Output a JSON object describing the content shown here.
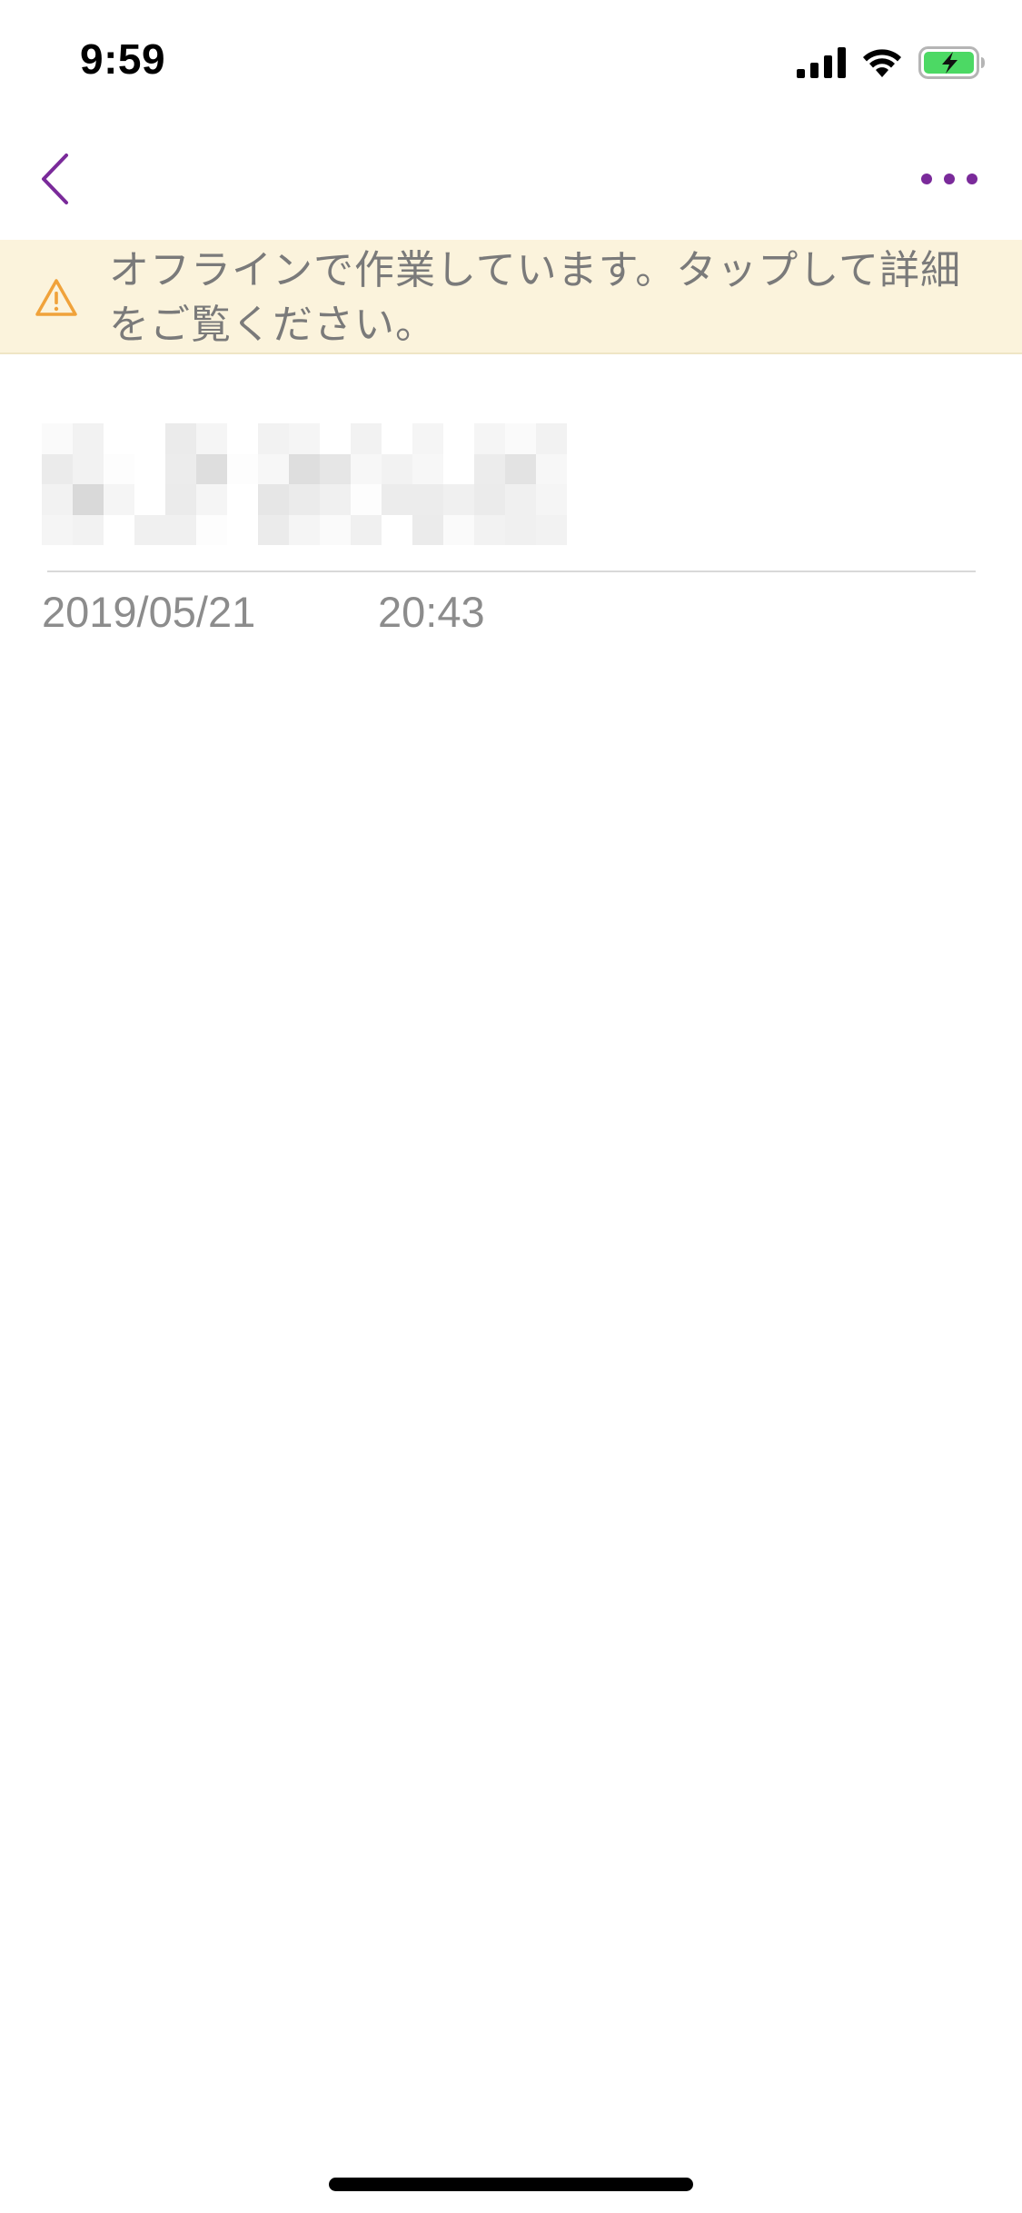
{
  "status_bar": {
    "time": "9:59",
    "signal_icon": "cellular-signal-icon",
    "wifi_icon": "wifi-icon",
    "battery_icon": "battery-charging-icon",
    "battery_color": "#4cd964"
  },
  "nav": {
    "back_icon": "chevron-left-icon",
    "more_icon": "more-horizontal-icon",
    "accent_color": "#7a2a9a"
  },
  "offline_banner": {
    "icon": "warning-triangle-icon",
    "icon_color": "#f0a23a",
    "background": "#fbf3dc",
    "message": "オフラインで作業しています。タップして詳細をご覧ください。"
  },
  "note": {
    "title_redacted": true,
    "date": "2019/05/21",
    "time": "20:43"
  }
}
